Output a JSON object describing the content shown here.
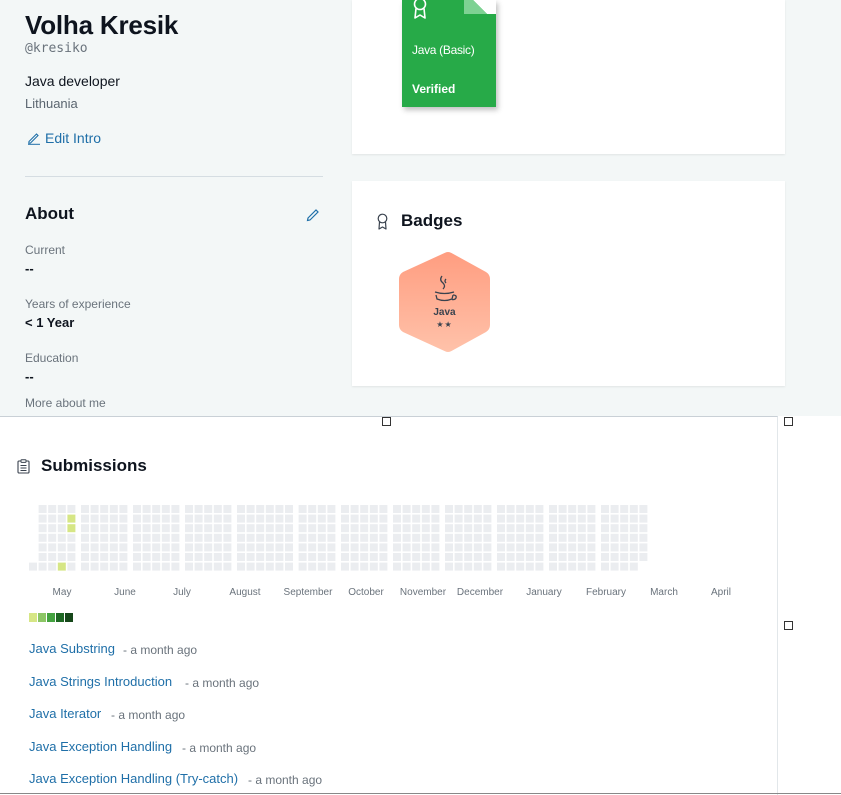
{
  "profile": {
    "name": "Volha Kresik",
    "username": "@kresiko",
    "job_title": "Java developer",
    "country": "Lithuania",
    "edit_intro_label": "Edit Intro"
  },
  "about": {
    "title": "About",
    "fields": [
      {
        "label": "Current",
        "value": "--"
      },
      {
        "label": "Years of experience",
        "value": "< 1 Year"
      },
      {
        "label": "Education",
        "value": "--"
      },
      {
        "label": "More about me",
        "value": ""
      }
    ]
  },
  "certificate": {
    "title": "Java (Basic)",
    "status": "Verified",
    "color": "#27aa48"
  },
  "badges": {
    "title": "Badges",
    "items": [
      {
        "name": "Java",
        "stars": "★★",
        "stars_count": 2,
        "color": "#ffaa8a"
      }
    ]
  },
  "submissions": {
    "title": "Submissions",
    "months": [
      "May",
      "June",
      "July",
      "August",
      "September",
      "October",
      "November",
      "December",
      "January",
      "February",
      "March",
      "April"
    ],
    "legend_colors": [
      "#d6e685",
      "#8cc665",
      "#44a340",
      "#1e6823",
      "#16471a"
    ],
    "items": [
      {
        "title": "Java Substring",
        "time": "- a month ago"
      },
      {
        "title": "Java Strings Introduction",
        "time": "- a month ago"
      },
      {
        "title": "Java Iterator",
        "time": "- a month ago"
      },
      {
        "title": "Java Exception Handling",
        "time": "- a month ago"
      },
      {
        "title": "Java Exception Handling (Try-catch)",
        "time": "- a month ago"
      }
    ]
  },
  "colors": {
    "accent": "#1f6fa8",
    "background": "#f3f7f7",
    "heatmap_empty": "#ebedf0",
    "heatmap_active": "#d6e685"
  }
}
